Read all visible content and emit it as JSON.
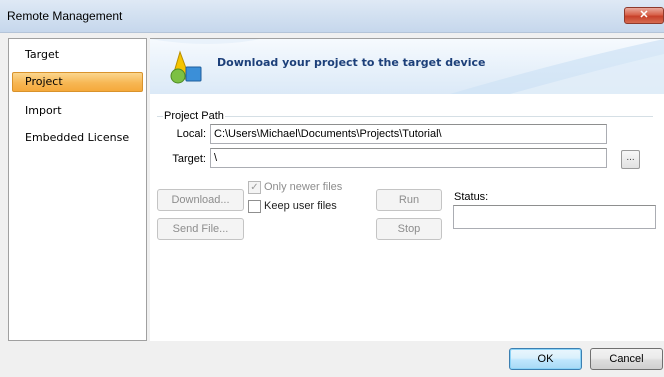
{
  "window": {
    "title": "Remote Management",
    "close_label": "✕"
  },
  "sidebar": {
    "items": [
      {
        "label": "Target",
        "selected": false
      },
      {
        "label": "Project",
        "selected": true
      },
      {
        "label": "Import",
        "selected": false
      },
      {
        "label": "Embedded License",
        "selected": false
      }
    ]
  },
  "banner": {
    "text": "Download your project to the target device",
    "icon": "shapes-icon"
  },
  "project_path": {
    "group_label": "Project Path",
    "local_label": "Local:",
    "local_value": "C:\\Users\\Michael\\Documents\\Projects\\Tutorial\\",
    "target_label": "Target:",
    "target_value": "\\",
    "browse_label": "..."
  },
  "actions": {
    "download_label": "Download...",
    "send_file_label": "Send File...",
    "only_newer_label": "Only newer files",
    "only_newer_checked": true,
    "keep_user_label": "Keep user files",
    "keep_user_checked": false,
    "run_label": "Run",
    "stop_label": "Stop",
    "status_label": "Status:",
    "status_value": ""
  },
  "footer": {
    "ok_label": "OK",
    "cancel_label": "Cancel"
  },
  "colors": {
    "selection": "#f7b754",
    "banner_text": "#1c3f79",
    "title_bar": "#d3e1f1"
  }
}
